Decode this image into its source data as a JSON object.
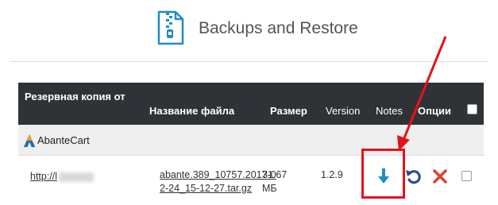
{
  "header": {
    "title": "Backups and Restore",
    "icon": "zip-file-icon",
    "icon_color": "#1f8dc3"
  },
  "table": {
    "columns": {
      "backup": "Резервная копия от",
      "filename": "Название файла",
      "size": "Размер",
      "version": "Version",
      "notes": "Notes",
      "options": "Опции"
    },
    "group": {
      "name": "AbanteCart"
    },
    "rows": [
      {
        "url": "http://l",
        "filename": "abante.389_10757.2017-02-24_15-12-27.tar.gz",
        "size": "31.67 МБ",
        "version": "1.2.9",
        "actions": [
          "download-icon",
          "restore-icon",
          "delete-icon"
        ]
      }
    ]
  },
  "colors": {
    "header_bg": "#2f3237",
    "highlight": "#e3131b",
    "download": "#1f8dc3",
    "restore": "#2b4f8f",
    "delete": "#e0403a"
  }
}
